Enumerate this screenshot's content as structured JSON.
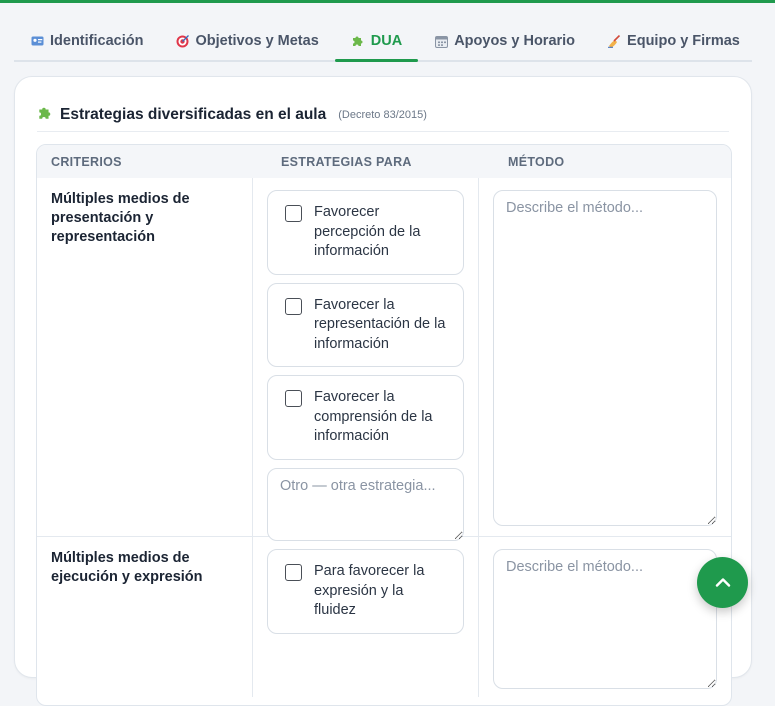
{
  "tabs": [
    {
      "label": "Identificación",
      "icon": "id-card-icon",
      "active": false
    },
    {
      "label": "Objetivos y Metas",
      "icon": "target-icon",
      "active": false
    },
    {
      "label": "DUA",
      "icon": "puzzle-icon",
      "active": true
    },
    {
      "label": "Apoyos y Horario",
      "icon": "calendar-icon",
      "active": false
    },
    {
      "label": "Equipo y Firmas",
      "icon": "writing-hand-icon",
      "active": false
    }
  ],
  "section": {
    "title": "Estrategias diversificadas en el aula",
    "subtitle": "(Decreto 83/2015)",
    "icon": "puzzle-icon"
  },
  "table": {
    "headers": [
      "CRITERIOS",
      "ESTRATEGIAS PARA",
      "MÉTODO"
    ],
    "rows": [
      {
        "criterio": "Múltiples medios de presentación y representación",
        "options": [
          "Favorecer percepción de la información",
          "Favorecer la representación de la información",
          "Favorecer la comprensión de la información"
        ],
        "otro_placeholder": "Otro — otra estrategia...",
        "metodo_placeholder": "Describe el método..."
      },
      {
        "criterio": "Múltiples medios de ejecución y expresión",
        "options": [
          "Para favorecer la expresión y la fluidez"
        ],
        "metodo_placeholder": "Describe el método..."
      }
    ]
  },
  "colors": {
    "accent": "#1f9a4d",
    "puzzle": "#6bb84a"
  }
}
